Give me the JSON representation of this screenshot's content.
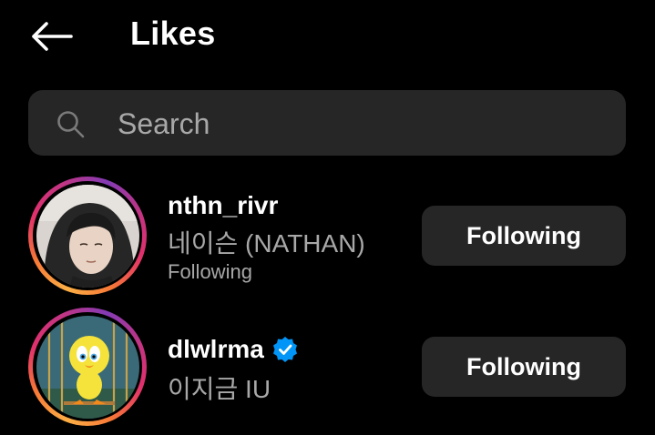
{
  "header": {
    "title": "Likes",
    "back_icon": "arrow-left-icon"
  },
  "search": {
    "placeholder": "Search",
    "value": "",
    "icon": "search-icon"
  },
  "users": [
    {
      "username": "nthn_rivr",
      "full_name": "네이슨 (NATHAN)",
      "status": "Following",
      "verified": false,
      "button_label": "Following",
      "avatar_icon": "profile-photo"
    },
    {
      "username": "dlwlrma",
      "full_name": "이지금 IU",
      "status": "",
      "verified": true,
      "button_label": "Following",
      "avatar_icon": "tweety-bird-avatar"
    }
  ],
  "colors": {
    "background": "#000000",
    "surface": "#262626",
    "secondary_text": "#a8a8a8",
    "verified_blue": "#0095f6"
  }
}
